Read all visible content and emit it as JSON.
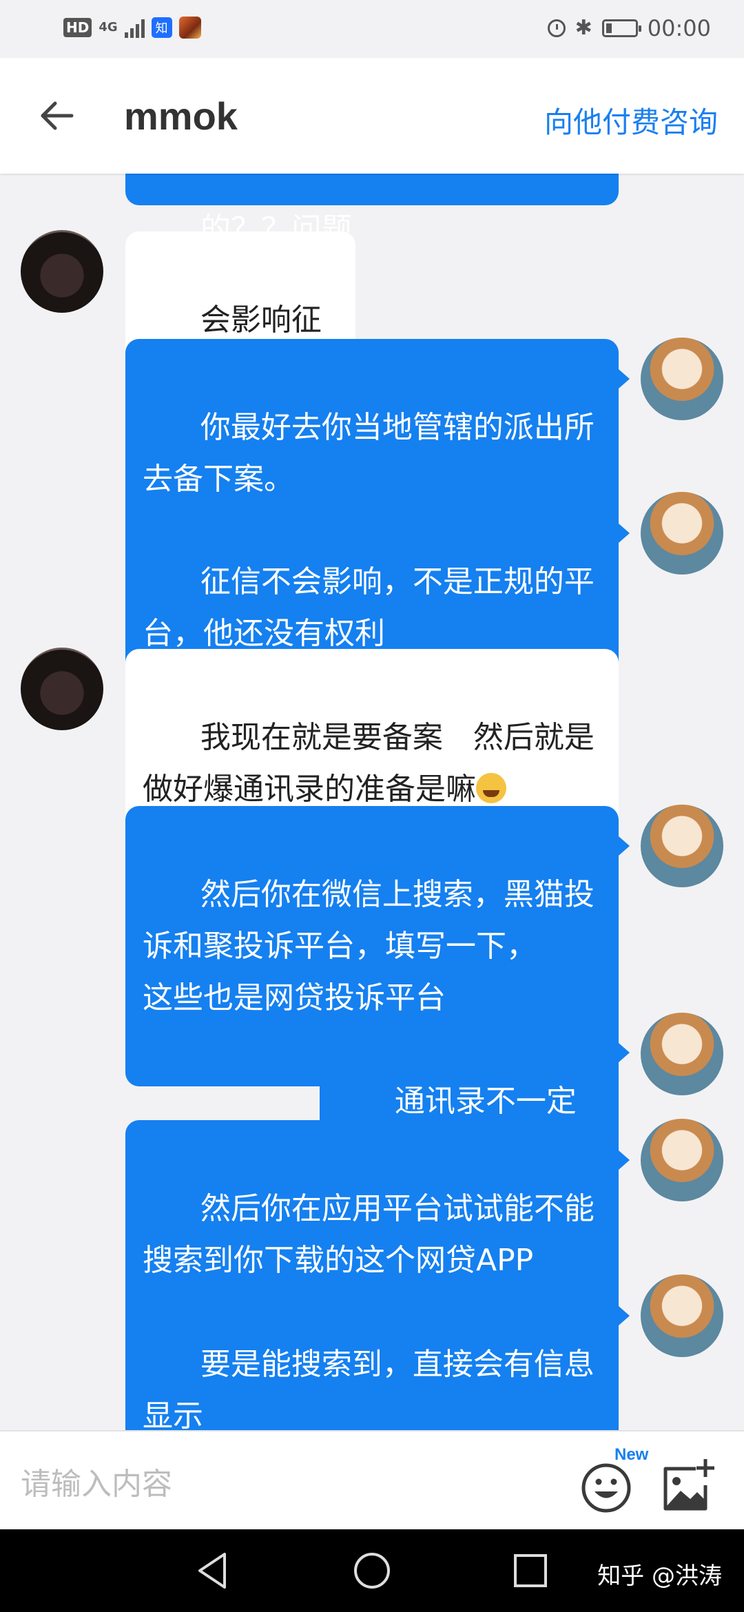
{
  "status_bar": {
    "hd": "HD",
    "network": "4G",
    "app_badge": "知",
    "time": "00:00"
  },
  "header": {
    "title": "mmok",
    "action_label": "向他付费咨询"
  },
  "messages": [
    {
      "side": "right",
      "text": "的？？问题"
    },
    {
      "side": "left",
      "text": "会影响征信吗"
    },
    {
      "side": "right",
      "text": "你最好去你当地管辖的派出所\n去备下案。"
    },
    {
      "side": "right",
      "text": "征信不会影响，不是正规的平\n台，他还没有权利"
    },
    {
      "side": "left",
      "text": "我现在就是要备案　然后就是\n做好爆通讯录的准备是嘛"
    },
    {
      "side": "right",
      "text": "然后你在微信上搜索，黑猫投\n诉和聚投诉平台，填写一下，\n这些也是网贷投诉平台"
    },
    {
      "side": "right",
      "text": "通讯录不一定会报"
    },
    {
      "side": "right",
      "text": "然后你在应用平台试试能不能\n搜索到你下载的这个网贷APP"
    },
    {
      "side": "right",
      "text": "要是能搜索到，直接会有信息\n显示"
    }
  ],
  "input": {
    "placeholder": "请输入内容",
    "new_badge": "New"
  },
  "nav": {
    "watermark": "知乎 @洪涛"
  },
  "colors": {
    "accent": "#1580f0",
    "header_action": "#1a7ff0",
    "background": "#f2f2f4"
  },
  "icons": [
    "back-arrow-icon",
    "emoji-icon",
    "add-image-icon",
    "nav-back-icon",
    "nav-home-icon",
    "nav-recents-icon",
    "alarm-icon",
    "bluetooth-icon",
    "battery-icon"
  ]
}
